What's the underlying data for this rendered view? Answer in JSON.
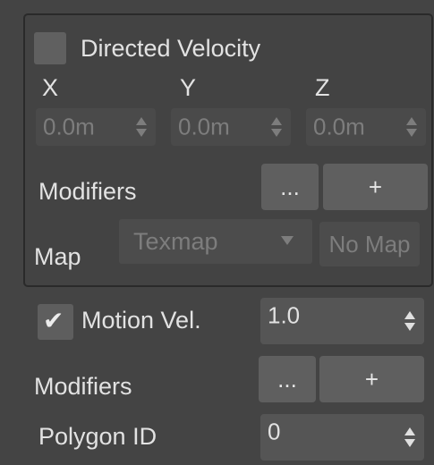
{
  "directed_velocity": {
    "label": "Directed Velocity",
    "checked": false,
    "axes": [
      {
        "label": "X",
        "value": "0.0m"
      },
      {
        "label": "Y",
        "value": "0.0m"
      },
      {
        "label": "Z",
        "value": "0.0m"
      }
    ],
    "modifiers_label": "Modifiers",
    "ellipsis_button": "...",
    "add_button": "+",
    "map_label": "Map",
    "texmap_value": "Texmap",
    "no_map_button": "No Map"
  },
  "motion_velocity": {
    "label": "Motion Vel.",
    "checkmark": "✔",
    "checked": true,
    "value": "1.0"
  },
  "modifiers": {
    "label": "Modifiers",
    "ellipsis_button": "...",
    "add_button": "+"
  },
  "polygon_id": {
    "label": "Polygon ID",
    "value": "0"
  },
  "colors": {
    "background": "#444444",
    "field": "#555555",
    "button": "#5f5f5f",
    "text": "#e2e2e2",
    "disabled_text": "#7d7d7d"
  }
}
